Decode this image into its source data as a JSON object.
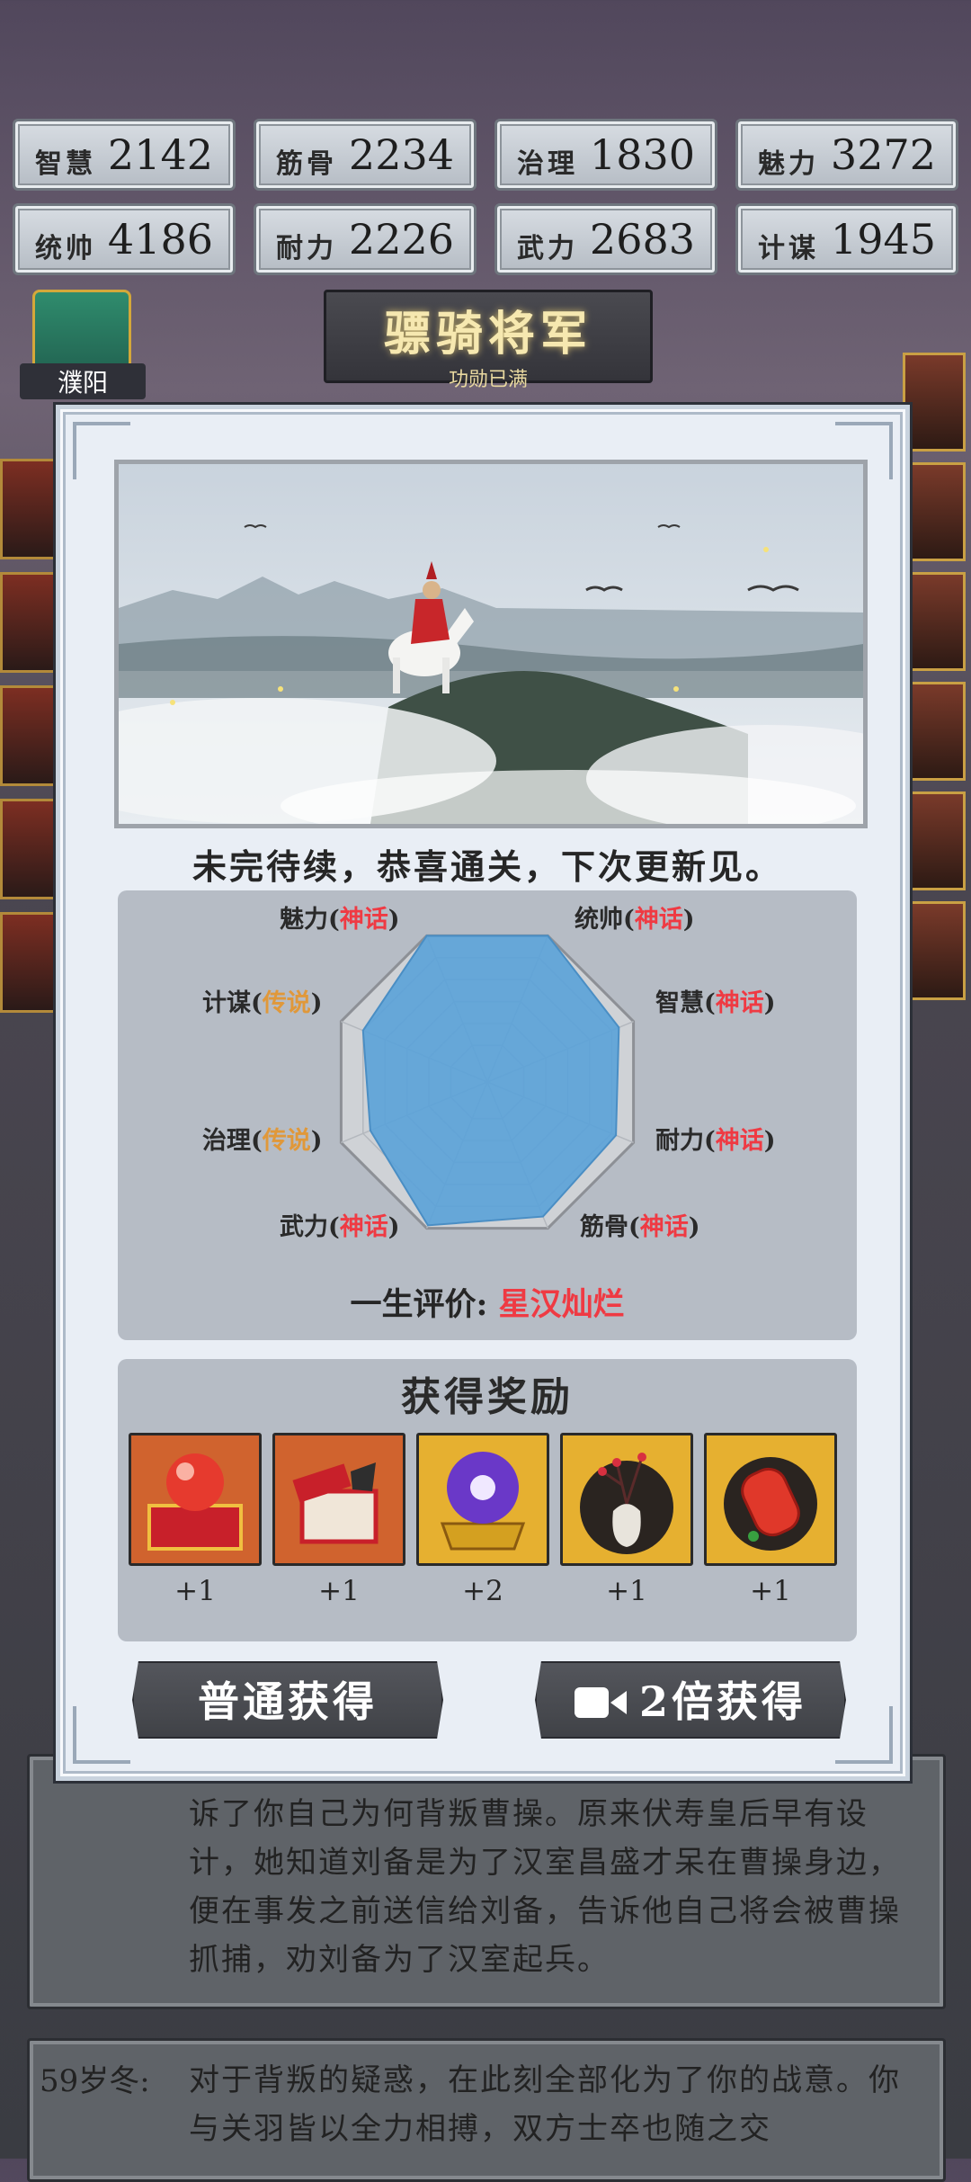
{
  "stats": [
    {
      "label": "智慧",
      "value": "2142"
    },
    {
      "label": "筋骨",
      "value": "2234"
    },
    {
      "label": "治理",
      "value": "1830"
    },
    {
      "label": "魅力",
      "value": "3272"
    },
    {
      "label": "统帅",
      "value": "4186"
    },
    {
      "label": "耐力",
      "value": "2226"
    },
    {
      "label": "武力",
      "value": "2683"
    },
    {
      "label": "计谋",
      "value": "1945"
    }
  ],
  "rank": {
    "title": "骠骑将军",
    "subtitle": "功勋已满"
  },
  "city": {
    "name": "濮阳"
  },
  "story": {
    "card1_text": "诉了你自己为何背叛曹操。原来伏寿皇后早有设计，她知道刘备是为了汉室昌盛才呆在曹操身边，便在事发之前送信给刘备，告诉他自己将会被曹操抓捕，劝刘备为了汉室起兵。",
    "card2_age": "59岁冬:",
    "card2_text": "对于背叛的疑惑，在此刻全部化为了你的战意。你与关羽皆以全力相搏，双方士卒也随之交"
  },
  "modal": {
    "ending_text": "未完待续，恭喜通关，下次更新见。",
    "attributes": [
      {
        "name": "统帅",
        "grade": "神话",
        "level": "myth",
        "value": 1.0
      },
      {
        "name": "智慧",
        "grade": "神话",
        "level": "myth",
        "value": 0.9
      },
      {
        "name": "耐力",
        "grade": "神话",
        "level": "myth",
        "value": 0.88
      },
      {
        "name": "筋骨",
        "grade": "神话",
        "level": "myth",
        "value": 0.92
      },
      {
        "name": "武力",
        "grade": "神话",
        "level": "myth",
        "value": 0.98
      },
      {
        "name": "治理",
        "grade": "传说",
        "level": "legend",
        "value": 0.8
      },
      {
        "name": "计谋",
        "grade": "传说",
        "level": "legend",
        "value": 0.85
      },
      {
        "name": "魅力",
        "grade": "神话",
        "level": "myth",
        "value": 1.0
      }
    ],
    "evaluation": {
      "label": "一生评价:",
      "value": "星汉灿烂"
    },
    "rewards_title": "获得奖励",
    "rewards": [
      {
        "icon": "red-orb-chest-icon",
        "count": "+1"
      },
      {
        "icon": "treasure-box-icon",
        "count": "+1"
      },
      {
        "icon": "purple-orb-icon",
        "count": "+2"
      },
      {
        "icon": "plum-vase-icon",
        "count": "+1"
      },
      {
        "icon": "red-lantern-icon",
        "count": "+1"
      }
    ],
    "buttons": {
      "normal": "普通获得",
      "double": "2倍获得"
    }
  },
  "colors": {
    "myth": "#ef3a43",
    "legend": "#e0983a",
    "radar_fill": "#5aa2d8"
  }
}
